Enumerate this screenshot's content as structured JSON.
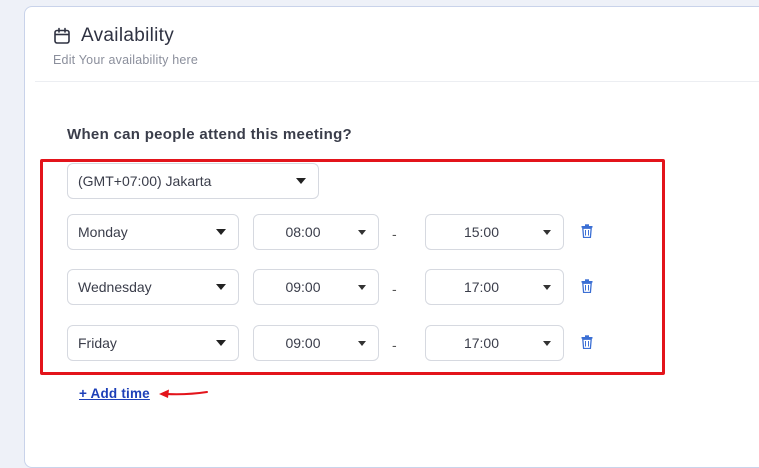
{
  "header": {
    "title": "Availability",
    "subtitle": "Edit Your availability here"
  },
  "question": "When can people attend this meeting?",
  "timezone": {
    "selected": "(GMT+07:00) Jakarta"
  },
  "rows": [
    {
      "day": "Monday",
      "start": "08:00",
      "end": "15:00"
    },
    {
      "day": "Wednesday",
      "start": "09:00",
      "end": "17:00"
    },
    {
      "day": "Friday",
      "start": "09:00",
      "end": "17:00"
    }
  ],
  "separator": "-",
  "add_time_label": "+ Add time",
  "icons": {
    "calendar": "calendar-icon",
    "trash": "trash-icon",
    "caret": "caret-down-icon",
    "annotation_arrow": "arrow-left-annotation"
  },
  "colors": {
    "highlight": "#e3141b",
    "link": "#1d3fb8",
    "trash": "#3b6fd4"
  }
}
